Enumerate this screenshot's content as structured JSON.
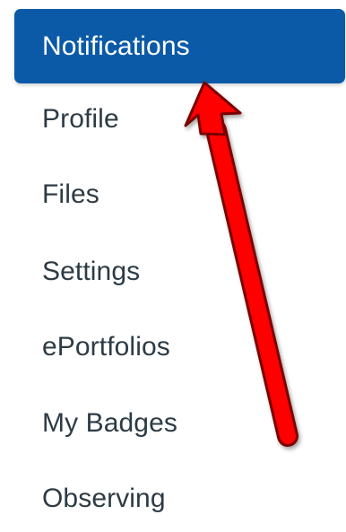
{
  "nav": {
    "items": [
      {
        "label": "Notifications",
        "active": true
      },
      {
        "label": "Profile",
        "active": false
      },
      {
        "label": "Files",
        "active": false
      },
      {
        "label": "Settings",
        "active": false
      },
      {
        "label": "ePortfolios",
        "active": false
      },
      {
        "label": "My Badges",
        "active": false
      },
      {
        "label": "Observing",
        "active": false
      }
    ]
  },
  "colors": {
    "active_background": "#0b5aa7",
    "active_text": "#ffffff",
    "text": "#2d3b45",
    "arrow": "#ff0000",
    "arrow_outline": "#7a0000"
  },
  "annotation": {
    "icon": "red-arrow-icon"
  }
}
